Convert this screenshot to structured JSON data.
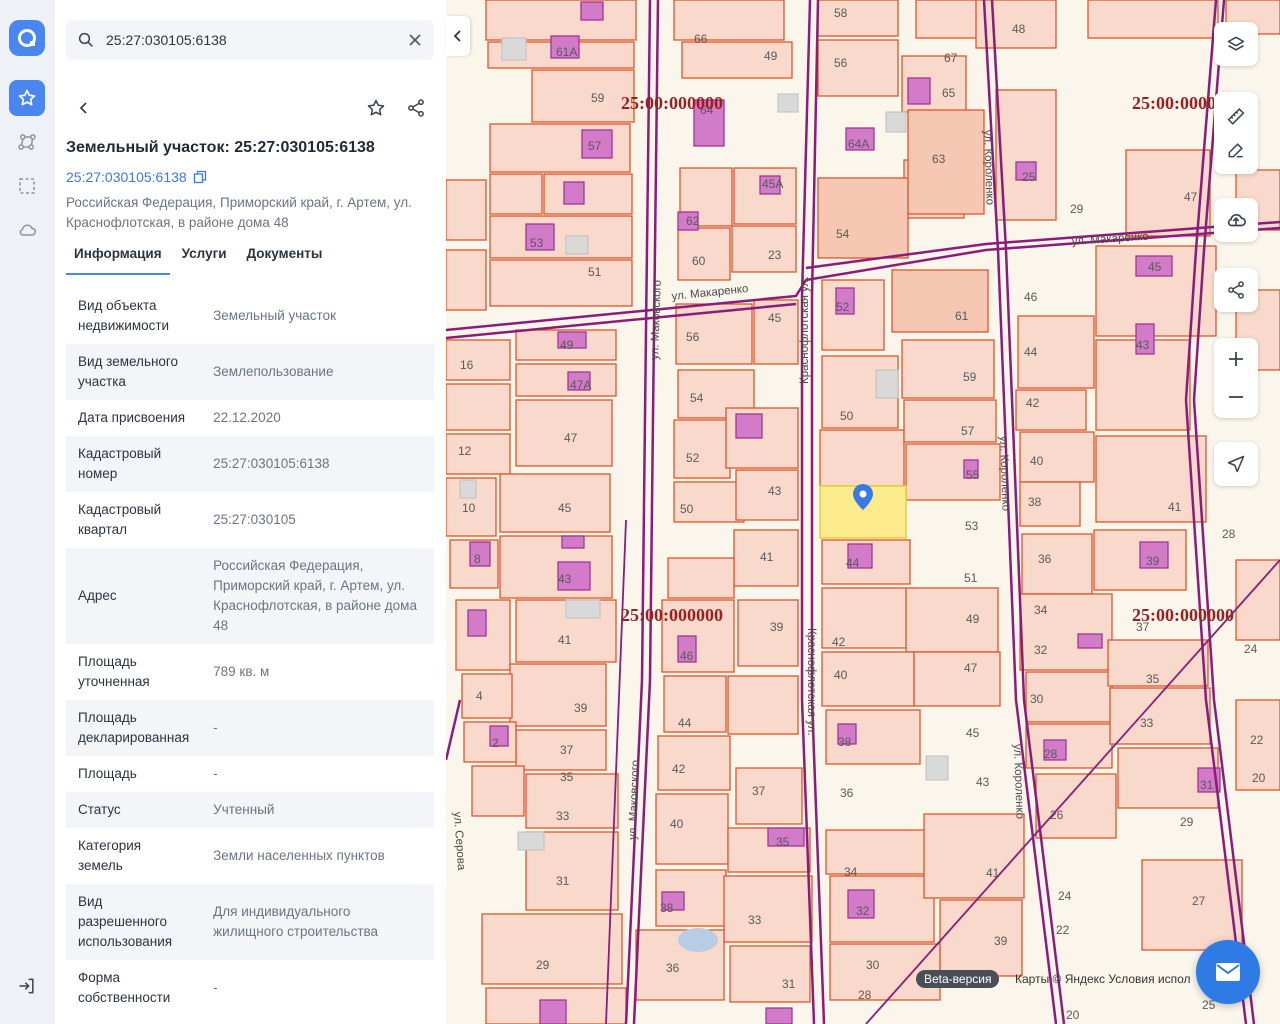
{
  "search": {
    "value": "25:27:030105:6138"
  },
  "object": {
    "title": "Земельный участок: 25:27:030105:6138",
    "number_link": "25:27:030105:6138",
    "address": "Российская Федерация, Приморский край, г. Артем, ул. Краснофлотская, в районе дома 48"
  },
  "tabs": [
    {
      "label": "Информация",
      "active": true
    },
    {
      "label": "Услуги",
      "active": false
    },
    {
      "label": "Документы",
      "active": false
    }
  ],
  "info_rows": [
    {
      "key": "Вид объекта недвижимости",
      "value": "Земельный участок"
    },
    {
      "key": "Вид земельного участка",
      "value": "Землепользование"
    },
    {
      "key": "Дата присвоения",
      "value": "22.12.2020"
    },
    {
      "key": "Кадастровый номер",
      "value": "25:27:030105:6138"
    },
    {
      "key": "Кадастровый квартал",
      "value": "25:27:030105"
    },
    {
      "key": "Адрес",
      "value": "Российская Федерация, Приморский край, г. Артем, ул. Краснофлотская, в районе дома 48"
    },
    {
      "key": "Площадь уточненная",
      "value": "789 кв. м"
    },
    {
      "key": "Площадь декларированная",
      "value": "-"
    },
    {
      "key": "Площадь",
      "value": "-"
    },
    {
      "key": "Статус",
      "value": "Учтенный"
    },
    {
      "key": "Категория земель",
      "value": "Земли населенных пунктов"
    },
    {
      "key": "Вид разрешенного использования",
      "value": "Для индивидуального жилищного строительства"
    },
    {
      "key": "Форма собственности",
      "value": "-"
    }
  ],
  "map": {
    "quarter_label": "25:00:000000",
    "streets": {
      "makarenko": "ул. Макаренко",
      "makovskogo": "ул. Маковского",
      "krasnoflotskaya": "Краснофлотская ул.",
      "korolenko": "ул. Короленко",
      "serova": "ул. Серова"
    },
    "beta_badge": "Beta-версия",
    "credits": "Карты © Яндекс   Условия испол",
    "colors": {
      "parcel_fill": "#f8d9cb",
      "parcel_stroke": "#e0552a",
      "building": "#d27bc9",
      "selected": "#fbeb8c",
      "street_line": "#8a1d7a",
      "quarter_text": "#9b1f1f"
    }
  },
  "icons": [
    "logo-icon",
    "favorites-icon",
    "graph-icon",
    "select-area-icon",
    "cloud-icon",
    "logout-icon",
    "search-icon",
    "clear-icon",
    "back-icon",
    "star-icon",
    "share-icon",
    "copy-icon",
    "layers-icon",
    "ruler-icon",
    "edit-icon",
    "upload-icon",
    "map-share-icon",
    "zoom-in-icon",
    "zoom-out-icon",
    "locate-icon",
    "mail-icon"
  ]
}
